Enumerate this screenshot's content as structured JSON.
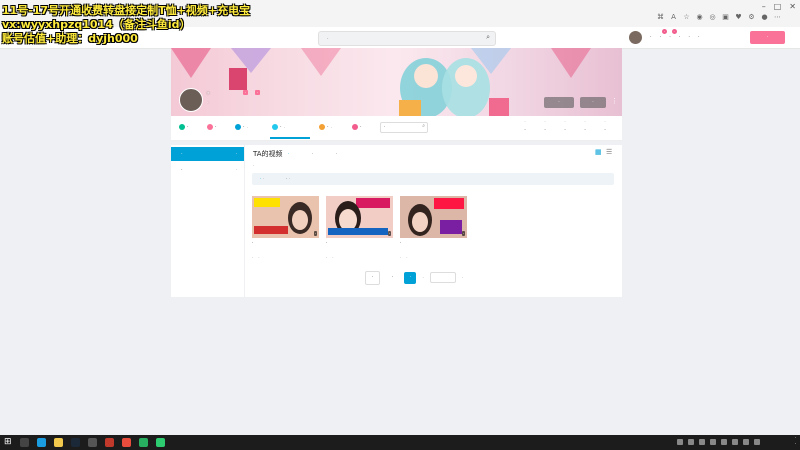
{
  "overlay": {
    "line1": "11号-17号开通收费转盘接定制T恤+视频+充电宝",
    "line2": "vx:wyyxhpzq1014（备注斗鱼id）",
    "line3": "账号估值+助理：dyjh000"
  },
  "header": {
    "search_placeholder": "·",
    "nav": [
      {
        "label": "·",
        "badge": ""
      },
      {
        "label": "·",
        "badge": "·"
      },
      {
        "label": "·",
        "badge": "·"
      },
      {
        "label": "·",
        "badge": ""
      },
      {
        "label": "·",
        "badge": ""
      },
      {
        "label": "·",
        "badge": ""
      }
    ],
    "upload_label": "·"
  },
  "profile": {
    "username": "·",
    "level_badge": "·",
    "vip_badge": "·",
    "sign": "·",
    "followed_label": "·",
    "message_label": "·"
  },
  "tabs": [
    {
      "label": "·",
      "count": "",
      "color": "#00c091"
    },
    {
      "label": "·",
      "count": "",
      "color": "#fb7299"
    },
    {
      "label": "·",
      "count": "·",
      "color": "#00a1d6"
    },
    {
      "label": "·",
      "count": "·",
      "color": "#23c9ed"
    },
    {
      "label": "·",
      "count": "·",
      "color": "#f3a034"
    },
    {
      "label": "·",
      "count": "",
      "color": "#f25d8e"
    }
  ],
  "space_search_value": "·",
  "stats": [
    {
      "label": "·",
      "value": "·"
    },
    {
      "label": "·",
      "value": "·"
    },
    {
      "label": "·",
      "value": "·"
    },
    {
      "label": "·",
      "value": "·"
    },
    {
      "label": "·",
      "value": "·"
    }
  ],
  "left_menu": [
    {
      "label": "·",
      "count": "·"
    },
    {
      "label": "·",
      "count": "·"
    }
  ],
  "content": {
    "title": "TA的视频",
    "sort_tabs": [
      "·",
      "·",
      "·"
    ],
    "search_summary": "·",
    "filters": [
      {
        "label": "·",
        "count": "·"
      },
      {
        "label": "·",
        "count": "·"
      }
    ]
  },
  "videos": [
    {
      "title": "·",
      "plays": "·",
      "date": "·",
      "duration": "·",
      "thumb_color": "#e9c3ad"
    },
    {
      "title": "·",
      "plays": "·",
      "date": "·",
      "duration": "·",
      "thumb_color": "#f1cdc6"
    },
    {
      "title": "·",
      "plays": "·",
      "date": "·",
      "duration": "·",
      "thumb_color": "#dcb7a8"
    }
  ],
  "pagination": {
    "prev_label": "·",
    "pages": [
      "·",
      "·"
    ],
    "current_page": "·",
    "total_text": "·",
    "page_suffix": "·"
  },
  "taskbar": {
    "time": "·",
    "date": "·"
  }
}
